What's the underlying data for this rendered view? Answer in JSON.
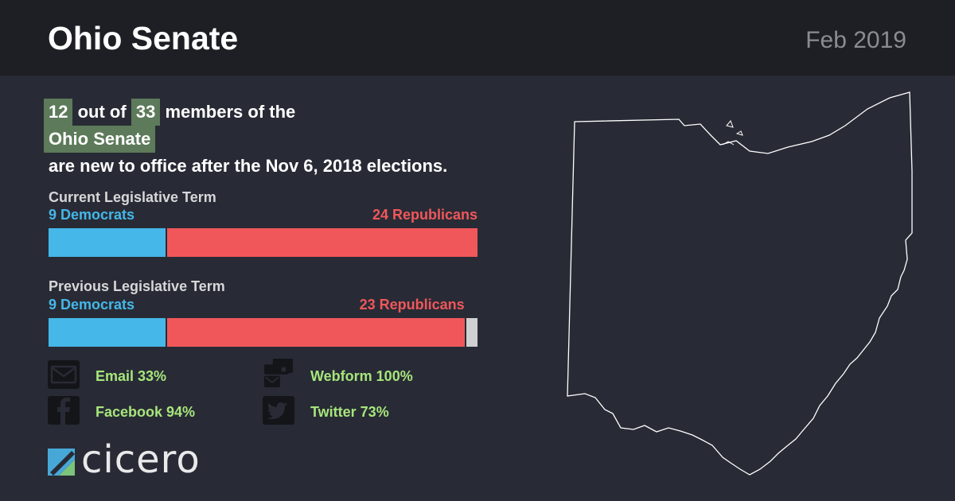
{
  "header": {
    "title": "Ohio Senate",
    "date": "Feb 2019"
  },
  "summary": {
    "new_count": "12",
    "line1_mid": "out of",
    "total": "33",
    "line1_end": "members of the",
    "body_name": "Ohio Senate",
    "line3": "are new to office after the Nov 6, 2018 elections."
  },
  "colors": {
    "democrat": "#45b7e8",
    "republican": "#f0575b",
    "other": "#cfd0d2",
    "highlight": "#5d7a5a",
    "contact": "#a7e57c"
  },
  "chart_data": [
    {
      "type": "bar",
      "title": "Current Legislative Term",
      "total_seats": 33,
      "series": [
        {
          "name": "Democrats",
          "value": 9,
          "label": "9 Democrats"
        },
        {
          "name": "Republicans",
          "value": 24,
          "label": "24 Republicans"
        }
      ]
    },
    {
      "type": "bar",
      "title": "Previous Legislative Term",
      "total_seats": 33,
      "series": [
        {
          "name": "Democrats",
          "value": 9,
          "label": "9 Democrats"
        },
        {
          "name": "Republicans",
          "value": 23,
          "label": "23 Republicans"
        },
        {
          "name": "Other",
          "value": 1,
          "label": ""
        }
      ]
    }
  ],
  "contacts": [
    {
      "icon": "email-icon",
      "label": "Email 33%",
      "value": 33
    },
    {
      "icon": "webform-icon",
      "label": "Webform 100%",
      "value": 100
    },
    {
      "icon": "facebook-icon",
      "label": "Facebook 94%",
      "value": 94
    },
    {
      "icon": "twitter-icon",
      "label": "Twitter 73%",
      "value": 73
    }
  ],
  "logo": {
    "text": "cicero"
  }
}
